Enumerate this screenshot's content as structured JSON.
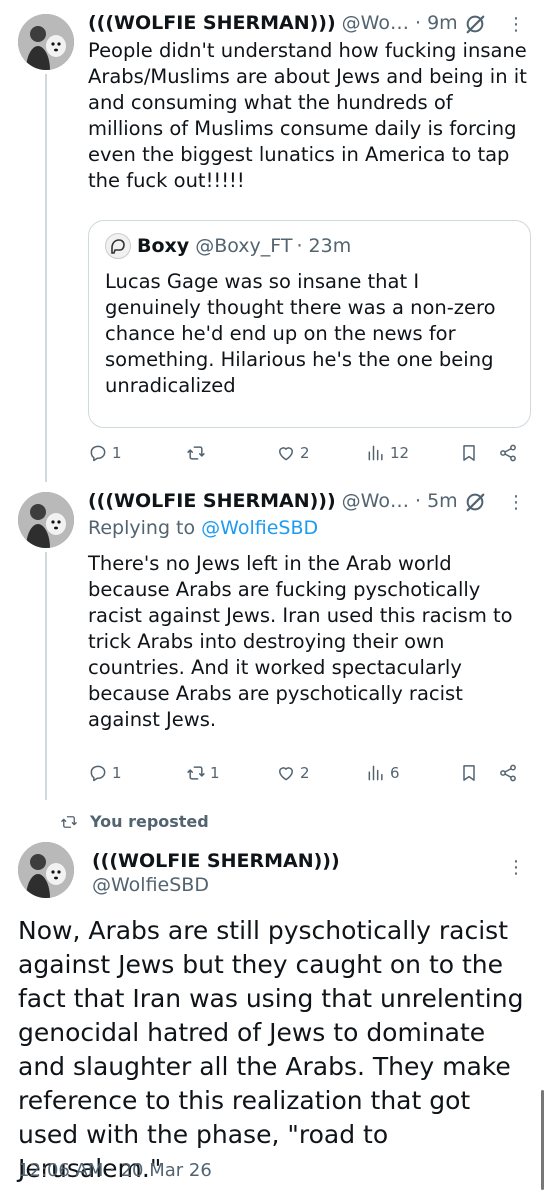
{
  "tweet1": {
    "display_name": "(((WOLFIE SHERMAN)))",
    "handle": "@Wo…",
    "time": "· 9m",
    "text": "People didn't understand how fucking insane Arabs/Muslims are about Jews and being in it and consuming what the hundreds of millions of Muslims consume daily is forcing even the biggest lunatics in America to tap the fuck out!!!!!",
    "quote": {
      "display_name": "Boxy",
      "handle": "@Boxy_FT",
      "time": "· 23m",
      "text": "Lucas Gage was so insane that I genuinely thought there was a non-zero chance he'd end up on the news for something. Hilarious he's the one being unradicalized"
    },
    "actions": {
      "replies": "1",
      "reposts": "",
      "likes": "2",
      "views": "12"
    }
  },
  "tweet2": {
    "display_name": "(((WOLFIE SHERMAN)))",
    "handle": "@Wo…",
    "time": "· 5m",
    "replying_prefix": "Replying to ",
    "replying_to": "@WolfieSBD",
    "text": "There's no Jews left in the Arab world because Arabs are fucking pyschotically racist against Jews. Iran used this racism to trick Arabs into destroying their own countries. And it worked spectacularly because Arabs are pyschotically racist against Jews.",
    "actions": {
      "replies": "1",
      "reposts": "1",
      "likes": "2",
      "views": "6"
    }
  },
  "repost_banner": "You reposted",
  "tweet3": {
    "display_name": "(((WOLFIE SHERMAN)))",
    "handle": "@WolfieSBD",
    "text": "Now, Arabs are still pyschotically racist against Jews but they caught on to the fact that Iran was using that unrelenting genocidal hatred of Jews to dominate and slaughter all the Arabs. They make reference to this realization that got used with the phase, \"road to Jerusalem.\"",
    "timestamp": "12:06 AM · 20 Mar 26"
  },
  "icons": {
    "reply": "speech-bubble-icon",
    "repost": "repost-arrows-icon",
    "like": "heart-icon",
    "views": "bar-chart-icon",
    "bookmark": "bookmark-icon",
    "share": "share-icon",
    "more": "more-vertical-icon",
    "grok": "grok-slash-circle-icon"
  },
  "colors": {
    "text": "#0f1419",
    "secondary": "#536471",
    "link": "#1d9bf0",
    "border": "#cfd9de"
  }
}
